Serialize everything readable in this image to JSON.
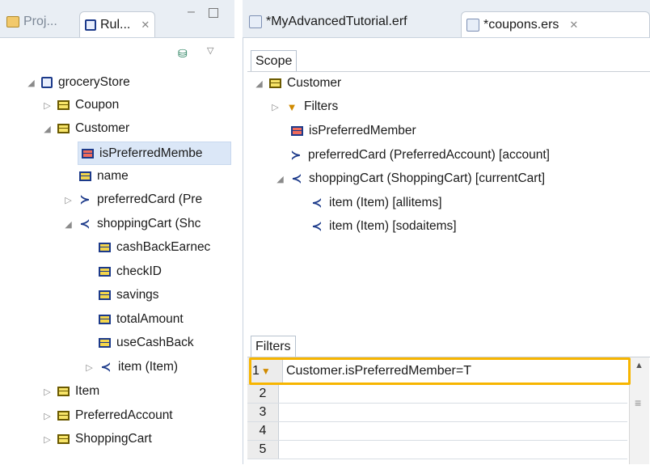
{
  "left": {
    "tabs": [
      {
        "label": "Proj...",
        "icon": "project-icon"
      },
      {
        "label": "Rul...",
        "icon": "rules-icon"
      }
    ],
    "tree": [
      {
        "label": "groceryStore",
        "icon": "book-icon",
        "twisty": "▲"
      },
      {
        "label": "Coupon",
        "icon": "class-icon",
        "twisty": "▷"
      },
      {
        "label": "Customer",
        "icon": "class-icon",
        "twisty": "▲"
      },
      {
        "label": "isPreferredMembe",
        "icon": "attr-red-icon",
        "twisty": ""
      },
      {
        "label": "name",
        "icon": "attr-yellow-icon",
        "twisty": ""
      },
      {
        "label": "preferredCard (Pre",
        "icon": "reference-icon",
        "twisty": "▷"
      },
      {
        "label": "shoppingCart (Shc",
        "icon": "collection-icon",
        "twisty": "▲"
      },
      {
        "label": "cashBackEarnec",
        "icon": "attr-yellow-icon",
        "twisty": ""
      },
      {
        "label": "checkID",
        "icon": "attr-yellow-icon",
        "twisty": ""
      },
      {
        "label": "savings",
        "icon": "attr-yellow-icon",
        "twisty": ""
      },
      {
        "label": "totalAmount",
        "icon": "attr-yellow-icon",
        "twisty": ""
      },
      {
        "label": "useCashBack",
        "icon": "attr-yellow-icon",
        "twisty": ""
      },
      {
        "label": "item (Item)",
        "icon": "collection-icon",
        "twisty": "▷"
      },
      {
        "label": "Item",
        "icon": "class-icon",
        "twisty": "▷"
      },
      {
        "label": "PreferredAccount",
        "icon": "class-icon",
        "twisty": "▷"
      },
      {
        "label": "ShoppingCart",
        "icon": "class-icon",
        "twisty": "▷"
      }
    ]
  },
  "right": {
    "tabs": [
      {
        "label": "*MyAdvancedTutorial.erf",
        "icon": "erf-icon"
      },
      {
        "label": "*coupons.ers",
        "icon": "ers-icon"
      }
    ],
    "scope_label": "Scope",
    "scope_tree": [
      {
        "label": "Customer",
        "icon": "class-icon",
        "twisty": "▲"
      },
      {
        "label": "Filters",
        "icon": "filter-icon",
        "twisty": "▷"
      },
      {
        "label": "isPreferredMember",
        "icon": "attr-red-icon",
        "twisty": ""
      },
      {
        "label": "preferredCard (PreferredAccount) [account]",
        "icon": "reference-icon",
        "twisty": ""
      },
      {
        "label": "shoppingCart (ShoppingCart) [currentCart]",
        "icon": "collection-icon",
        "twisty": "▲"
      },
      {
        "label": "item (Item) [allitems]",
        "icon": "collection-icon",
        "twisty": ""
      },
      {
        "label": "item (Item) [sodaitems]",
        "icon": "collection-icon",
        "twisty": ""
      }
    ],
    "filters_label": "Filters",
    "filters_rows": [
      {
        "num": "1",
        "expr": "Customer.isPreferredMember=T"
      },
      {
        "num": "2",
        "expr": ""
      },
      {
        "num": "3",
        "expr": ""
      },
      {
        "num": "4",
        "expr": ""
      },
      {
        "num": "5",
        "expr": ""
      }
    ]
  }
}
